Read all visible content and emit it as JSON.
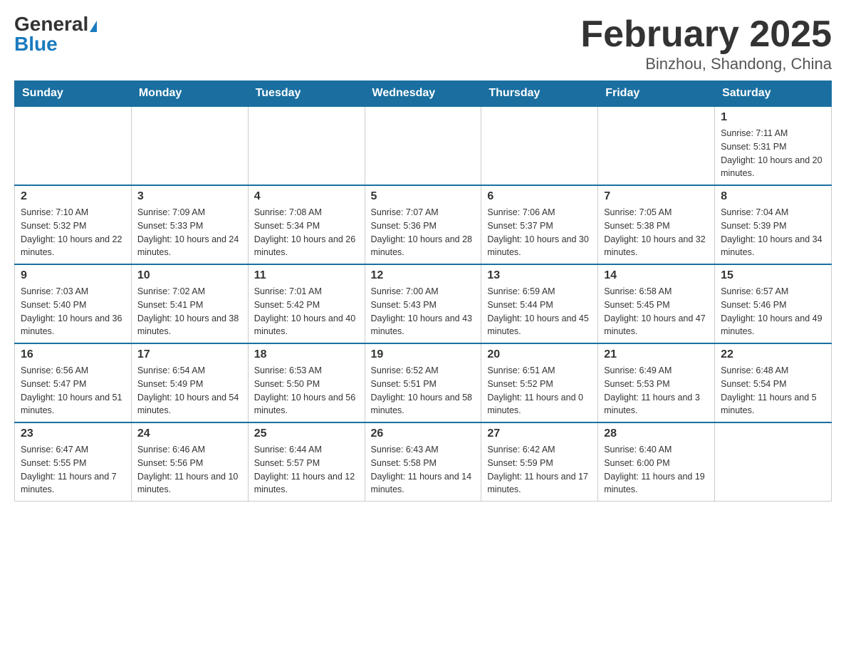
{
  "header": {
    "logo_general": "General",
    "logo_blue": "Blue",
    "month_title": "February 2025",
    "location": "Binzhou, Shandong, China"
  },
  "weekdays": [
    "Sunday",
    "Monday",
    "Tuesday",
    "Wednesday",
    "Thursday",
    "Friday",
    "Saturday"
  ],
  "weeks": [
    [
      {
        "day": "",
        "sunrise": "",
        "sunset": "",
        "daylight": ""
      },
      {
        "day": "",
        "sunrise": "",
        "sunset": "",
        "daylight": ""
      },
      {
        "day": "",
        "sunrise": "",
        "sunset": "",
        "daylight": ""
      },
      {
        "day": "",
        "sunrise": "",
        "sunset": "",
        "daylight": ""
      },
      {
        "day": "",
        "sunrise": "",
        "sunset": "",
        "daylight": ""
      },
      {
        "day": "",
        "sunrise": "",
        "sunset": "",
        "daylight": ""
      },
      {
        "day": "1",
        "sunrise": "Sunrise: 7:11 AM",
        "sunset": "Sunset: 5:31 PM",
        "daylight": "Daylight: 10 hours and 20 minutes."
      }
    ],
    [
      {
        "day": "2",
        "sunrise": "Sunrise: 7:10 AM",
        "sunset": "Sunset: 5:32 PM",
        "daylight": "Daylight: 10 hours and 22 minutes."
      },
      {
        "day": "3",
        "sunrise": "Sunrise: 7:09 AM",
        "sunset": "Sunset: 5:33 PM",
        "daylight": "Daylight: 10 hours and 24 minutes."
      },
      {
        "day": "4",
        "sunrise": "Sunrise: 7:08 AM",
        "sunset": "Sunset: 5:34 PM",
        "daylight": "Daylight: 10 hours and 26 minutes."
      },
      {
        "day": "5",
        "sunrise": "Sunrise: 7:07 AM",
        "sunset": "Sunset: 5:36 PM",
        "daylight": "Daylight: 10 hours and 28 minutes."
      },
      {
        "day": "6",
        "sunrise": "Sunrise: 7:06 AM",
        "sunset": "Sunset: 5:37 PM",
        "daylight": "Daylight: 10 hours and 30 minutes."
      },
      {
        "day": "7",
        "sunrise": "Sunrise: 7:05 AM",
        "sunset": "Sunset: 5:38 PM",
        "daylight": "Daylight: 10 hours and 32 minutes."
      },
      {
        "day": "8",
        "sunrise": "Sunrise: 7:04 AM",
        "sunset": "Sunset: 5:39 PM",
        "daylight": "Daylight: 10 hours and 34 minutes."
      }
    ],
    [
      {
        "day": "9",
        "sunrise": "Sunrise: 7:03 AM",
        "sunset": "Sunset: 5:40 PM",
        "daylight": "Daylight: 10 hours and 36 minutes."
      },
      {
        "day": "10",
        "sunrise": "Sunrise: 7:02 AM",
        "sunset": "Sunset: 5:41 PM",
        "daylight": "Daylight: 10 hours and 38 minutes."
      },
      {
        "day": "11",
        "sunrise": "Sunrise: 7:01 AM",
        "sunset": "Sunset: 5:42 PM",
        "daylight": "Daylight: 10 hours and 40 minutes."
      },
      {
        "day": "12",
        "sunrise": "Sunrise: 7:00 AM",
        "sunset": "Sunset: 5:43 PM",
        "daylight": "Daylight: 10 hours and 43 minutes."
      },
      {
        "day": "13",
        "sunrise": "Sunrise: 6:59 AM",
        "sunset": "Sunset: 5:44 PM",
        "daylight": "Daylight: 10 hours and 45 minutes."
      },
      {
        "day": "14",
        "sunrise": "Sunrise: 6:58 AM",
        "sunset": "Sunset: 5:45 PM",
        "daylight": "Daylight: 10 hours and 47 minutes."
      },
      {
        "day": "15",
        "sunrise": "Sunrise: 6:57 AM",
        "sunset": "Sunset: 5:46 PM",
        "daylight": "Daylight: 10 hours and 49 minutes."
      }
    ],
    [
      {
        "day": "16",
        "sunrise": "Sunrise: 6:56 AM",
        "sunset": "Sunset: 5:47 PM",
        "daylight": "Daylight: 10 hours and 51 minutes."
      },
      {
        "day": "17",
        "sunrise": "Sunrise: 6:54 AM",
        "sunset": "Sunset: 5:49 PM",
        "daylight": "Daylight: 10 hours and 54 minutes."
      },
      {
        "day": "18",
        "sunrise": "Sunrise: 6:53 AM",
        "sunset": "Sunset: 5:50 PM",
        "daylight": "Daylight: 10 hours and 56 minutes."
      },
      {
        "day": "19",
        "sunrise": "Sunrise: 6:52 AM",
        "sunset": "Sunset: 5:51 PM",
        "daylight": "Daylight: 10 hours and 58 minutes."
      },
      {
        "day": "20",
        "sunrise": "Sunrise: 6:51 AM",
        "sunset": "Sunset: 5:52 PM",
        "daylight": "Daylight: 11 hours and 0 minutes."
      },
      {
        "day": "21",
        "sunrise": "Sunrise: 6:49 AM",
        "sunset": "Sunset: 5:53 PM",
        "daylight": "Daylight: 11 hours and 3 minutes."
      },
      {
        "day": "22",
        "sunrise": "Sunrise: 6:48 AM",
        "sunset": "Sunset: 5:54 PM",
        "daylight": "Daylight: 11 hours and 5 minutes."
      }
    ],
    [
      {
        "day": "23",
        "sunrise": "Sunrise: 6:47 AM",
        "sunset": "Sunset: 5:55 PM",
        "daylight": "Daylight: 11 hours and 7 minutes."
      },
      {
        "day": "24",
        "sunrise": "Sunrise: 6:46 AM",
        "sunset": "Sunset: 5:56 PM",
        "daylight": "Daylight: 11 hours and 10 minutes."
      },
      {
        "day": "25",
        "sunrise": "Sunrise: 6:44 AM",
        "sunset": "Sunset: 5:57 PM",
        "daylight": "Daylight: 11 hours and 12 minutes."
      },
      {
        "day": "26",
        "sunrise": "Sunrise: 6:43 AM",
        "sunset": "Sunset: 5:58 PM",
        "daylight": "Daylight: 11 hours and 14 minutes."
      },
      {
        "day": "27",
        "sunrise": "Sunrise: 6:42 AM",
        "sunset": "Sunset: 5:59 PM",
        "daylight": "Daylight: 11 hours and 17 minutes."
      },
      {
        "day": "28",
        "sunrise": "Sunrise: 6:40 AM",
        "sunset": "Sunset: 6:00 PM",
        "daylight": "Daylight: 11 hours and 19 minutes."
      },
      {
        "day": "",
        "sunrise": "",
        "sunset": "",
        "daylight": ""
      }
    ]
  ]
}
